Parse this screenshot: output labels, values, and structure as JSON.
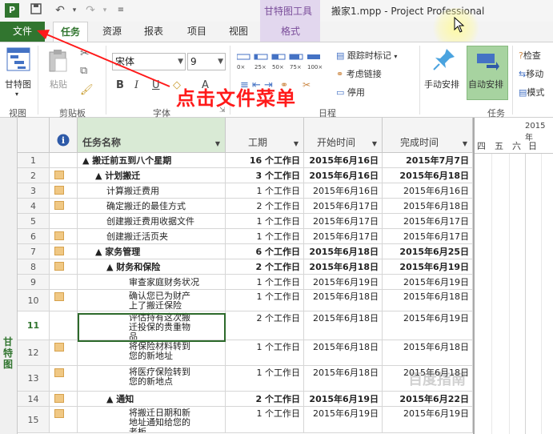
{
  "title_bar": {
    "app_icon": "P",
    "context_group": "甘特图工具",
    "window_title": "搬家1.mpp - Project Professional"
  },
  "tabs": {
    "file": "文件",
    "items": [
      "任务",
      "资源",
      "报表",
      "项目",
      "视图",
      "格式"
    ]
  },
  "ribbon": {
    "view": {
      "button": "甘特图",
      "label": "视图"
    },
    "clipboard": {
      "paste": "粘贴",
      "label": "剪贴板"
    },
    "font": {
      "name": "宋体",
      "size": "9",
      "label": "字体"
    },
    "schedule": {
      "items": [
        "跟踪时标记",
        "考虑链接",
        "停用"
      ],
      "label": "日程"
    },
    "tasks": {
      "manual": "手动安排",
      "auto": "自动安排",
      "label": "任务"
    },
    "right": {
      "items": [
        "检查",
        "移动",
        "模式"
      ]
    }
  },
  "annotation": "点击文件菜单",
  "sidebar_label": "甘特图",
  "table": {
    "headers": {
      "info": "i",
      "name": "任务名称",
      "duration": "工期",
      "start": "开始时间",
      "finish": "完成时间"
    },
    "rows": [
      {
        "id": "1",
        "name": "▲ 搬迁前五到八个星期",
        "duration": "16 个工作日",
        "start": "2015年6月16日",
        "finish": "2015年7月7日",
        "bold": true,
        "indent": 0,
        "icon": false
      },
      {
        "id": "2",
        "name": "▲ 计划搬迁",
        "duration": "3 个工作日",
        "start": "2015年6月16日",
        "finish": "2015年6月18日",
        "bold": true,
        "indent": 1,
        "icon": true
      },
      {
        "id": "3",
        "name": "计算搬迁费用",
        "duration": "1 个工作日",
        "start": "2015年6月16日",
        "finish": "2015年6月16日",
        "bold": false,
        "indent": 2,
        "icon": true
      },
      {
        "id": "4",
        "name": "确定搬迁的最佳方式",
        "duration": "2 个工作日",
        "start": "2015年6月17日",
        "finish": "2015年6月18日",
        "bold": false,
        "indent": 2,
        "icon": true
      },
      {
        "id": "5",
        "name": "创建搬迁费用收据文件",
        "duration": "1 个工作日",
        "start": "2015年6月17日",
        "finish": "2015年6月17日",
        "bold": false,
        "indent": 2,
        "icon": false
      },
      {
        "id": "6",
        "name": "创建搬迁活页夹",
        "duration": "1 个工作日",
        "start": "2015年6月17日",
        "finish": "2015年6月17日",
        "bold": false,
        "indent": 2,
        "icon": true
      },
      {
        "id": "7",
        "name": "▲ 家务管理",
        "duration": "6 个工作日",
        "start": "2015年6月18日",
        "finish": "2015年6月25日",
        "bold": true,
        "indent": 1,
        "icon": true
      },
      {
        "id": "8",
        "name": "▲ 财务和保险",
        "duration": "2 个工作日",
        "start": "2015年6月18日",
        "finish": "2015年6月19日",
        "bold": true,
        "indent": 2,
        "icon": true
      },
      {
        "id": "9",
        "name": "审查家庭财务状况",
        "duration": "1 个工作日",
        "start": "2015年6月19日",
        "finish": "2015年6月19日",
        "bold": false,
        "indent": 3,
        "icon": false
      },
      {
        "id": "10",
        "name": "确认您已为财产上了搬迁保险",
        "duration": "1 个工作日",
        "start": "2015年6月18日",
        "finish": "2015年6月18日",
        "bold": false,
        "indent": 3,
        "icon": true
      },
      {
        "id": "11",
        "name": "评估持有这次搬迁投保的贵重物品",
        "duration": "2 个工作日",
        "start": "2015年6月18日",
        "finish": "2015年6月19日",
        "bold": false,
        "indent": 3,
        "icon": false
      },
      {
        "id": "12",
        "name": "将保险材料转到您的新地址",
        "duration": "1 个工作日",
        "start": "2015年6月18日",
        "finish": "2015年6月18日",
        "bold": false,
        "indent": 3,
        "icon": true
      },
      {
        "id": "13",
        "name": "将医疗保险转到您的新地点",
        "duration": "1 个工作日",
        "start": "2015年6月18日",
        "finish": "2015年6月18日",
        "bold": false,
        "indent": 3,
        "icon": true
      },
      {
        "id": "14",
        "name": "▲ 通知",
        "duration": "2 个工作日",
        "start": "2015年6月19日",
        "finish": "2015年6月22日",
        "bold": true,
        "indent": 2,
        "icon": true
      },
      {
        "id": "15",
        "name": "将搬迁日期和新地址通知给您的老板",
        "duration": "1 个工作日",
        "start": "2015年6月19日",
        "finish": "2015年6月19日",
        "bold": false,
        "indent": 3,
        "icon": true
      }
    ]
  },
  "chart": {
    "year": "2015年",
    "days": [
      "四",
      "五",
      "六",
      "日"
    ]
  },
  "watermark": "百度指南",
  "colors": {
    "accent": "#31752f",
    "annotation": "#ff1a1a",
    "context": "#7a4d9a"
  }
}
